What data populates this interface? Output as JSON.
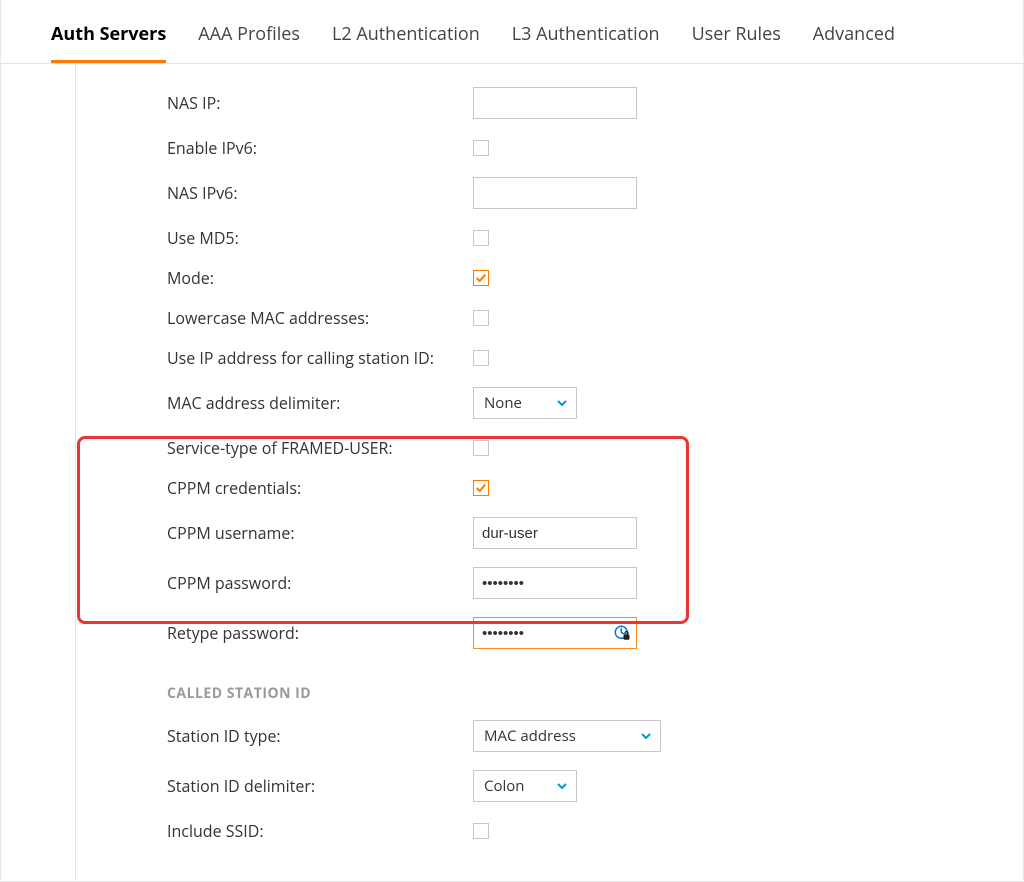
{
  "tabs": {
    "auth_servers": "Auth Servers",
    "aaa_profiles": "AAA Profiles",
    "l2_auth": "L2 Authentication",
    "l3_auth": "L3 Authentication",
    "user_rules": "User Rules",
    "advanced": "Advanced"
  },
  "active_tab": "auth_servers",
  "fields": {
    "nas_ip": {
      "label": "NAS IP:",
      "value": ""
    },
    "enable_ipv6": {
      "label": "Enable IPv6:",
      "checked": false
    },
    "nas_ipv6": {
      "label": "NAS IPv6:",
      "value": ""
    },
    "use_md5": {
      "label": "Use MD5:",
      "checked": false
    },
    "mode": {
      "label": "Mode:",
      "checked": true
    },
    "lowercase_mac": {
      "label": "Lowercase MAC addresses:",
      "checked": false
    },
    "use_ip_calling_station": {
      "label": "Use IP address for calling station ID:",
      "checked": false
    },
    "mac_delimiter": {
      "label": "MAC address delimiter:",
      "value": "None"
    },
    "service_type_framed": {
      "label": "Service-type of FRAMED-USER:",
      "checked": false
    },
    "cppm_credentials": {
      "label": "CPPM credentials:",
      "checked": true
    },
    "cppm_username": {
      "label": "CPPM username:",
      "value": "dur-user"
    },
    "cppm_password": {
      "label": "CPPM password:",
      "value": "••••••••"
    },
    "retype_password": {
      "label": "Retype password:",
      "value": "••••••••"
    }
  },
  "called_station": {
    "section_title": "CALLED STATION ID",
    "station_id_type": {
      "label": "Station ID type:",
      "value": "MAC address"
    },
    "station_id_delimiter": {
      "label": "Station ID delimiter:",
      "value": "Colon"
    },
    "include_ssid": {
      "label": "Include SSID:",
      "checked": false
    }
  }
}
